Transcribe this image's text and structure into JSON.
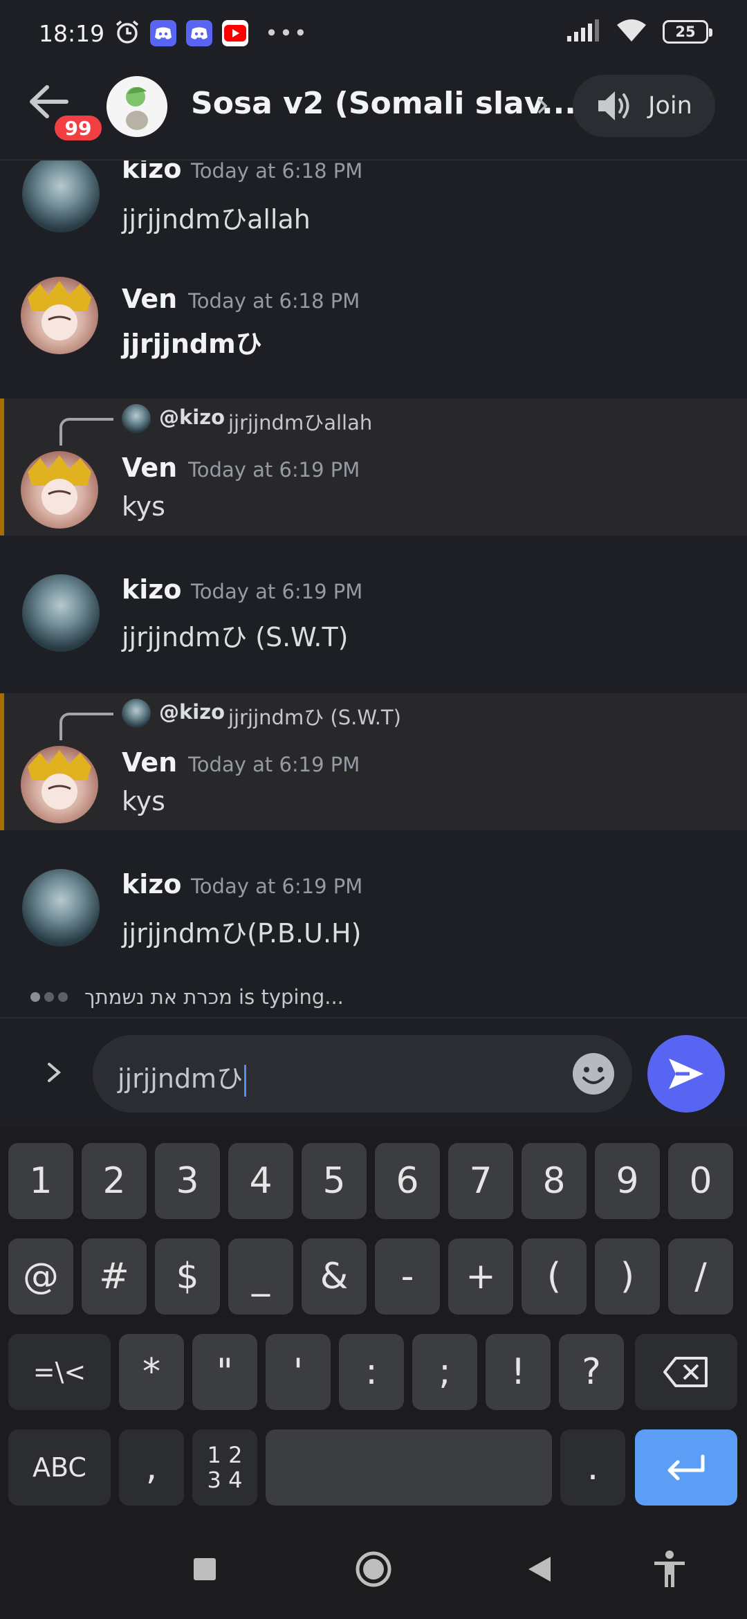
{
  "status_bar": {
    "time": "18:19",
    "battery": "25",
    "overflow": "•••",
    "icons": [
      "alarm-icon",
      "discord-icon",
      "discord-icon",
      "youtube-icon",
      "signal-icon",
      "wifi-icon",
      "battery-icon"
    ]
  },
  "header": {
    "notification_count": "99",
    "channel_title": "Sosa v2 (Somali slav...",
    "join_label": "Join"
  },
  "messages": [
    {
      "author": "kizo",
      "timestamp": "Today at 6:18 PM",
      "content": "jjrjjndmひallah"
    },
    {
      "author": "Ven",
      "timestamp": "Today at 6:18 PM",
      "content": "jjrjjndmひ"
    },
    {
      "author": "Ven",
      "timestamp": "Today at 6:19 PM",
      "content": "kys",
      "reply": {
        "name": "@kizo",
        "text": "jjrjjndmひallah"
      }
    },
    {
      "author": "kizo",
      "timestamp": "Today at 6:19 PM",
      "content": "jjrjjndmひ (S.W.T)"
    },
    {
      "author": "Ven",
      "timestamp": "Today at 6:19 PM",
      "content": "kys",
      "reply": {
        "name": "@kizo",
        "text": "jjrjjndmひ (S.W.T)"
      }
    },
    {
      "author": "kizo",
      "timestamp": "Today at 6:19 PM",
      "content": "jjrjjndmひ(P.B.U.H)"
    }
  ],
  "typing_indicator": "מכרת את נשמתך is typing...",
  "composer": {
    "value": "jjrjjndmひ"
  },
  "keyboard": {
    "row1": [
      "1",
      "2",
      "3",
      "4",
      "5",
      "6",
      "7",
      "8",
      "9",
      "0"
    ],
    "row2": [
      "@",
      "#",
      "$",
      "_",
      "&",
      "-",
      "+",
      "(",
      ")",
      "/"
    ],
    "row3": [
      "=\\<",
      "*",
      "\"",
      "'",
      ":",
      ";",
      "!",
      "?"
    ],
    "row4_abc": "ABC",
    "row4_comma": ",",
    "row4_numpad_top": "1 2",
    "row4_numpad_bottom": "3 4",
    "row4_period": "."
  },
  "colors": {
    "background": "#1e1f24",
    "mention_highlight": "#28282b",
    "mention_bar": "#a66d00",
    "accent": "#5865f2",
    "badge": "#f23f43",
    "enter_key": "#5c9ef5"
  }
}
